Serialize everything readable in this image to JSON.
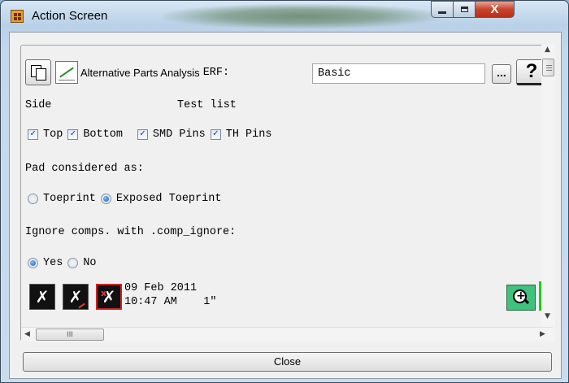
{
  "window": {
    "title": "Action Screen",
    "icon": "grid-app-icon",
    "controls": {
      "minimize_icon": "minimize-icon",
      "maximize_icon": "maximize-icon",
      "close_symbol": "X"
    }
  },
  "toolbar": {
    "alt_label": "Alternative Parts Analysis",
    "erf_label": "ERF:",
    "erf_value": "Basic",
    "ellipsis_label": "...",
    "help_label": "?"
  },
  "side": {
    "label": "Side",
    "options": [
      {
        "label": "Top",
        "checked": true
      },
      {
        "label": "Bottom",
        "checked": true
      }
    ]
  },
  "test_list": {
    "label": "Test list",
    "options": [
      {
        "label": "SMD Pins",
        "checked": true
      },
      {
        "label": "TH Pins",
        "checked": true
      }
    ]
  },
  "pad": {
    "label": "Pad considered as:",
    "options": [
      {
        "label": "Toeprint",
        "selected": false
      },
      {
        "label": "Exposed Toeprint",
        "selected": true
      }
    ]
  },
  "ignore": {
    "label": "Ignore comps. with .comp_ignore:",
    "options": [
      {
        "label": "Yes",
        "selected": true
      },
      {
        "label": "No",
        "selected": false
      }
    ]
  },
  "status": {
    "date": "09 Feb 2011",
    "time": "10:47 AM",
    "duration": "1\""
  },
  "scrollbar": {
    "thumb_grip": "III"
  },
  "footer": {
    "close_label": "Close"
  },
  "colors": {
    "accent_green": "#3ec27d",
    "indicator_green": "#18d018"
  }
}
